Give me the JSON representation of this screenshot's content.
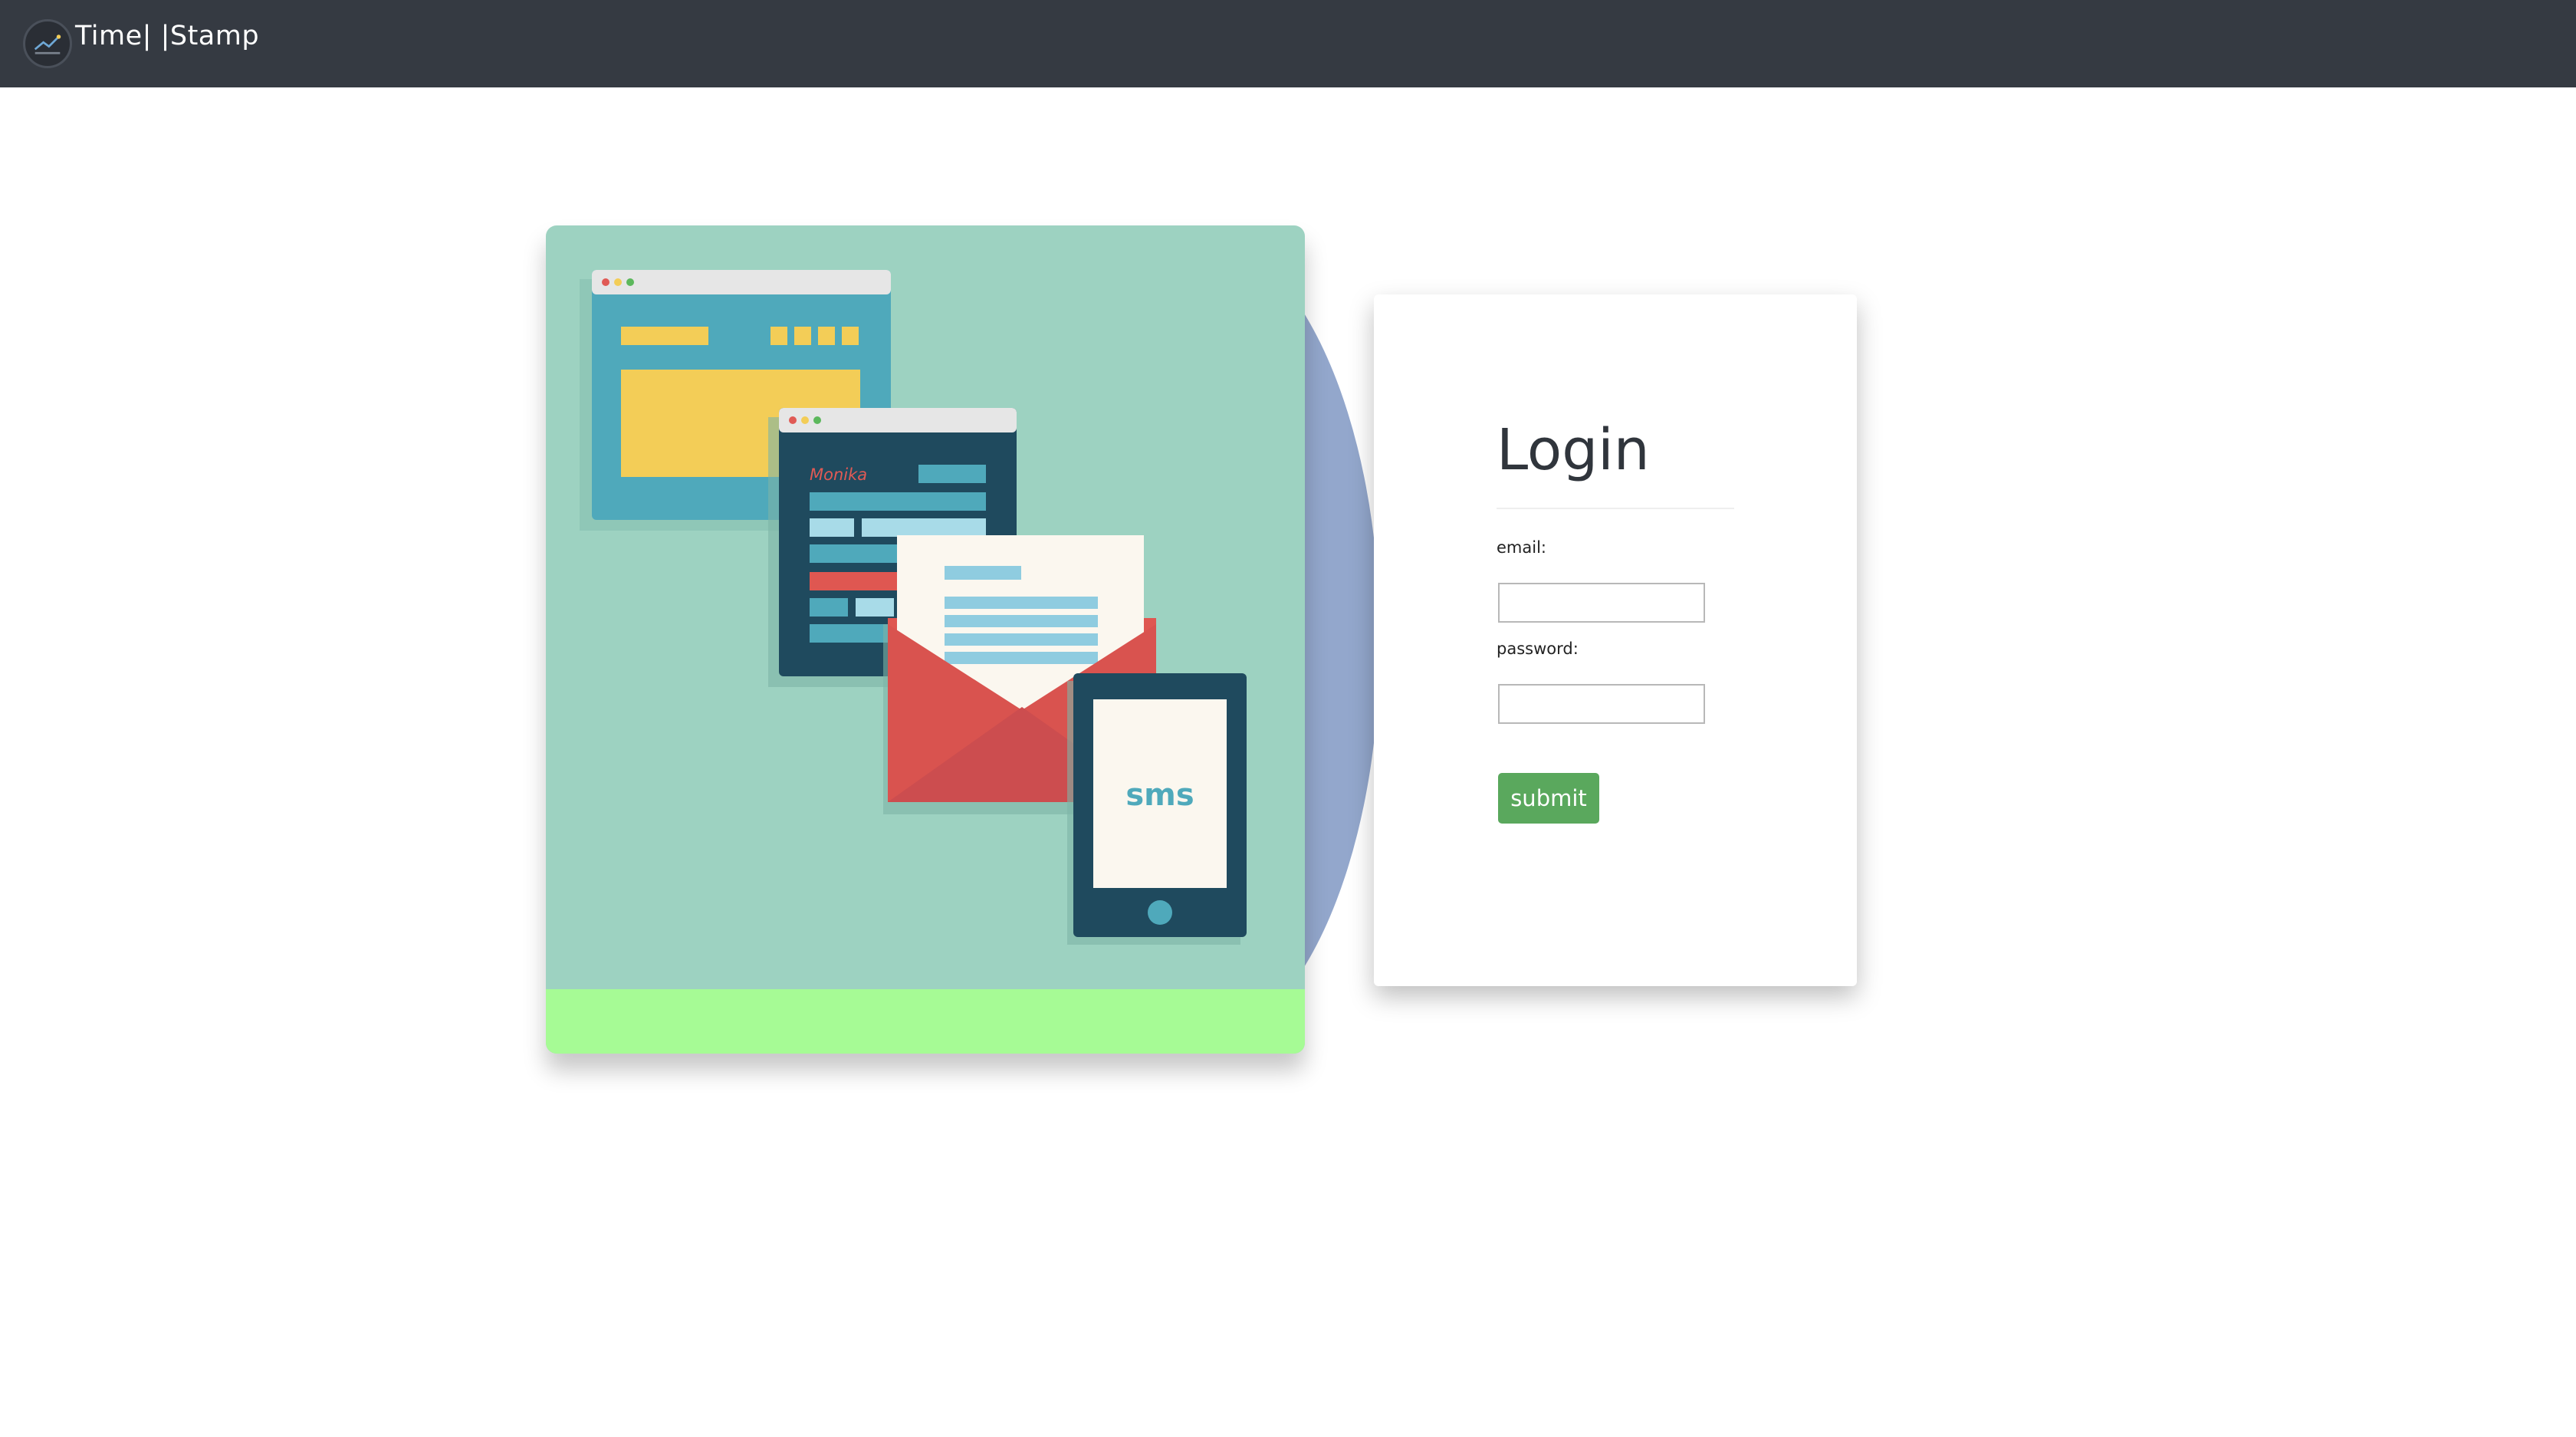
{
  "navbar": {
    "brand_name": "Time| |Stamp",
    "logo_icon": "timestamp-logo-icon",
    "bg_color": "#353a42"
  },
  "illustration": {
    "profile_name": "Monika",
    "phone_text": "sms",
    "colors": {
      "background": "#9dd2c1",
      "footer_strip": "#a6fb95",
      "half_moon": "#93a7cc",
      "envelope": "#df5751",
      "dark_panel": "#1f4a5e",
      "teal": "#4fa9bb",
      "yellow": "#f3cd57"
    }
  },
  "login": {
    "title": "Login",
    "email_label": "email:",
    "email_value": "",
    "password_label": "password:",
    "password_value": "",
    "submit_label": "submit",
    "submit_color": "#5aa85d"
  }
}
